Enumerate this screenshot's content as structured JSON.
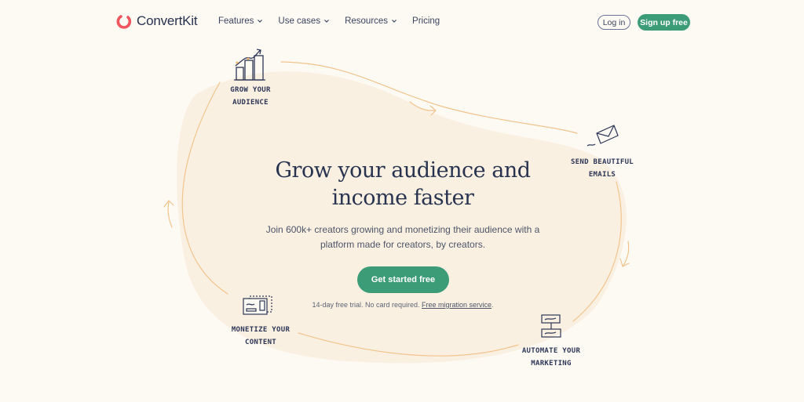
{
  "brand": {
    "name": "ConvertKit",
    "accent": "#f0545c",
    "primary_green": "#3d9c78",
    "text_navy": "#283350"
  },
  "nav": {
    "items": [
      {
        "label": "Features",
        "has_dropdown": true
      },
      {
        "label": "Use cases",
        "has_dropdown": true
      },
      {
        "label": "Resources",
        "has_dropdown": true
      },
      {
        "label": "Pricing",
        "has_dropdown": false
      }
    ],
    "login_label": "Log in",
    "signup_label": "Sign up free"
  },
  "hero": {
    "title_line1": "Grow your audience and",
    "title_line2": "income faster",
    "subtitle": "Join 600k+ creators growing and monetizing their audience with a platform made for creators, by creators.",
    "cta_label": "Get started free",
    "note_text": "14-day free trial. No card required. ",
    "note_link": "Free migration service",
    "note_end": "."
  },
  "cycle": [
    {
      "icon": "bar-chart-icon",
      "line1": "GROW YOUR",
      "line2": "AUDIENCE"
    },
    {
      "icon": "envelope-icon",
      "line1": "SEND BEAUTIFUL",
      "line2": "EMAILS"
    },
    {
      "icon": "workflow-icon",
      "line1": "AUTOMATE YOUR",
      "line2": "MARKETING"
    },
    {
      "icon": "payment-card-icon",
      "line1": "MONETIZE YOUR",
      "line2": "CONTENT"
    }
  ]
}
